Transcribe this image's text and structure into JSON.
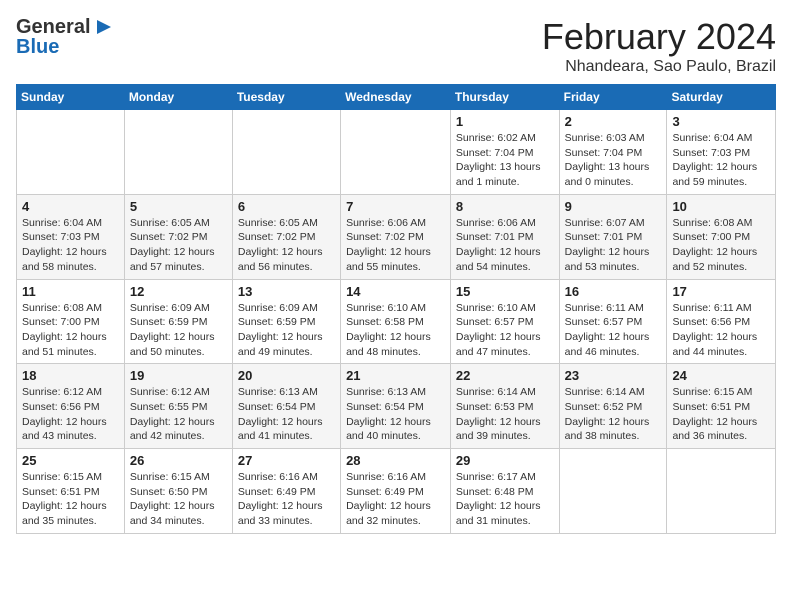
{
  "header": {
    "logo_line1": "General",
    "logo_line2": "Blue",
    "month": "February 2024",
    "location": "Nhandeara, Sao Paulo, Brazil"
  },
  "days_of_week": [
    "Sunday",
    "Monday",
    "Tuesday",
    "Wednesday",
    "Thursday",
    "Friday",
    "Saturday"
  ],
  "weeks": [
    [
      {
        "day": "",
        "info": ""
      },
      {
        "day": "",
        "info": ""
      },
      {
        "day": "",
        "info": ""
      },
      {
        "day": "",
        "info": ""
      },
      {
        "day": "1",
        "info": "Sunrise: 6:02 AM\nSunset: 7:04 PM\nDaylight: 13 hours\nand 1 minute."
      },
      {
        "day": "2",
        "info": "Sunrise: 6:03 AM\nSunset: 7:04 PM\nDaylight: 13 hours\nand 0 minutes."
      },
      {
        "day": "3",
        "info": "Sunrise: 6:04 AM\nSunset: 7:03 PM\nDaylight: 12 hours\nand 59 minutes."
      }
    ],
    [
      {
        "day": "4",
        "info": "Sunrise: 6:04 AM\nSunset: 7:03 PM\nDaylight: 12 hours\nand 58 minutes."
      },
      {
        "day": "5",
        "info": "Sunrise: 6:05 AM\nSunset: 7:02 PM\nDaylight: 12 hours\nand 57 minutes."
      },
      {
        "day": "6",
        "info": "Sunrise: 6:05 AM\nSunset: 7:02 PM\nDaylight: 12 hours\nand 56 minutes."
      },
      {
        "day": "7",
        "info": "Sunrise: 6:06 AM\nSunset: 7:02 PM\nDaylight: 12 hours\nand 55 minutes."
      },
      {
        "day": "8",
        "info": "Sunrise: 6:06 AM\nSunset: 7:01 PM\nDaylight: 12 hours\nand 54 minutes."
      },
      {
        "day": "9",
        "info": "Sunrise: 6:07 AM\nSunset: 7:01 PM\nDaylight: 12 hours\nand 53 minutes."
      },
      {
        "day": "10",
        "info": "Sunrise: 6:08 AM\nSunset: 7:00 PM\nDaylight: 12 hours\nand 52 minutes."
      }
    ],
    [
      {
        "day": "11",
        "info": "Sunrise: 6:08 AM\nSunset: 7:00 PM\nDaylight: 12 hours\nand 51 minutes."
      },
      {
        "day": "12",
        "info": "Sunrise: 6:09 AM\nSunset: 6:59 PM\nDaylight: 12 hours\nand 50 minutes."
      },
      {
        "day": "13",
        "info": "Sunrise: 6:09 AM\nSunset: 6:59 PM\nDaylight: 12 hours\nand 49 minutes."
      },
      {
        "day": "14",
        "info": "Sunrise: 6:10 AM\nSunset: 6:58 PM\nDaylight: 12 hours\nand 48 minutes."
      },
      {
        "day": "15",
        "info": "Sunrise: 6:10 AM\nSunset: 6:57 PM\nDaylight: 12 hours\nand 47 minutes."
      },
      {
        "day": "16",
        "info": "Sunrise: 6:11 AM\nSunset: 6:57 PM\nDaylight: 12 hours\nand 46 minutes."
      },
      {
        "day": "17",
        "info": "Sunrise: 6:11 AM\nSunset: 6:56 PM\nDaylight: 12 hours\nand 44 minutes."
      }
    ],
    [
      {
        "day": "18",
        "info": "Sunrise: 6:12 AM\nSunset: 6:56 PM\nDaylight: 12 hours\nand 43 minutes."
      },
      {
        "day": "19",
        "info": "Sunrise: 6:12 AM\nSunset: 6:55 PM\nDaylight: 12 hours\nand 42 minutes."
      },
      {
        "day": "20",
        "info": "Sunrise: 6:13 AM\nSunset: 6:54 PM\nDaylight: 12 hours\nand 41 minutes."
      },
      {
        "day": "21",
        "info": "Sunrise: 6:13 AM\nSunset: 6:54 PM\nDaylight: 12 hours\nand 40 minutes."
      },
      {
        "day": "22",
        "info": "Sunrise: 6:14 AM\nSunset: 6:53 PM\nDaylight: 12 hours\nand 39 minutes."
      },
      {
        "day": "23",
        "info": "Sunrise: 6:14 AM\nSunset: 6:52 PM\nDaylight: 12 hours\nand 38 minutes."
      },
      {
        "day": "24",
        "info": "Sunrise: 6:15 AM\nSunset: 6:51 PM\nDaylight: 12 hours\nand 36 minutes."
      }
    ],
    [
      {
        "day": "25",
        "info": "Sunrise: 6:15 AM\nSunset: 6:51 PM\nDaylight: 12 hours\nand 35 minutes."
      },
      {
        "day": "26",
        "info": "Sunrise: 6:15 AM\nSunset: 6:50 PM\nDaylight: 12 hours\nand 34 minutes."
      },
      {
        "day": "27",
        "info": "Sunrise: 6:16 AM\nSunset: 6:49 PM\nDaylight: 12 hours\nand 33 minutes."
      },
      {
        "day": "28",
        "info": "Sunrise: 6:16 AM\nSunset: 6:49 PM\nDaylight: 12 hours\nand 32 minutes."
      },
      {
        "day": "29",
        "info": "Sunrise: 6:17 AM\nSunset: 6:48 PM\nDaylight: 12 hours\nand 31 minutes."
      },
      {
        "day": "",
        "info": ""
      },
      {
        "day": "",
        "info": ""
      }
    ]
  ]
}
